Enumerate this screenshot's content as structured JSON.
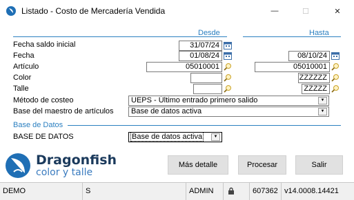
{
  "window": {
    "title": "Listado - Costo de Mercadería Vendida",
    "minimize_glyph": "—",
    "maximize_glyph": "☐",
    "close_glyph": "✕"
  },
  "columns": {
    "desde": "Desde",
    "hasta": "Hasta"
  },
  "fields": {
    "fecha_saldo_inicial": {
      "label": "Fecha saldo inicial",
      "desde": "31/07/24"
    },
    "fecha": {
      "label": "Fecha",
      "desde": "01/08/24",
      "hasta": "08/10/24"
    },
    "articulo": {
      "label": "Artículo",
      "desde": "05010001",
      "hasta": "05010001"
    },
    "color": {
      "label": "Color",
      "desde": "",
      "hasta": "ZZZZZZ"
    },
    "talle": {
      "label": "Talle",
      "desde": "",
      "hasta": "ZZZZZ"
    }
  },
  "metodo_costeo": {
    "label": "Método de costeo",
    "value": "UEPS - Último entrado primero salido"
  },
  "base_maestro": {
    "label": "Base del maestro de artículos",
    "value": "Base de datos activa"
  },
  "base_datos_section": {
    "title": "Base de Datos",
    "label": "BASE DE DATOS",
    "value": "Base de datos activa"
  },
  "brand": {
    "name": "Dragonfish",
    "tagline": "color y talle",
    "accent": "#1f6fb5"
  },
  "buttons": {
    "mas_detalle": "Más detalle",
    "procesar": "Procesar",
    "salir": "Salir"
  },
  "status": {
    "env": "DEMO",
    "mode": "S",
    "user": "ADMIN",
    "lock_icon": "lock-icon",
    "number": "607362",
    "version": "v14.0008.14421"
  },
  "icons": {
    "calendar": "calendar-icon",
    "search": "magnifier-icon",
    "dropdown": "chevron-down-icon"
  }
}
